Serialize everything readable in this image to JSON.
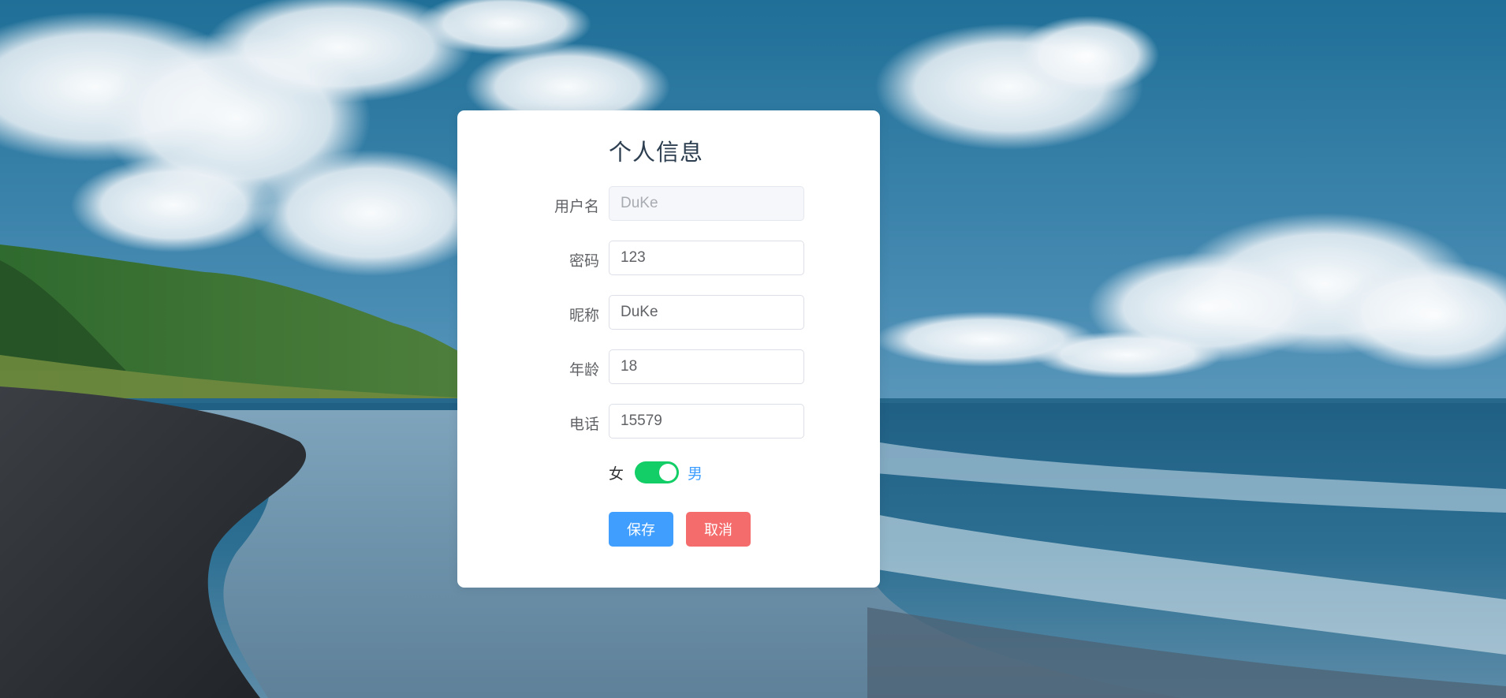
{
  "form": {
    "title": "个人信息",
    "fields": [
      {
        "label": "用户名",
        "value": "DuKe",
        "disabled": true
      },
      {
        "label": "密码",
        "value": "123",
        "disabled": false
      },
      {
        "label": "昵称",
        "value": "DuKe",
        "disabled": false
      },
      {
        "label": "年龄",
        "value": "18",
        "disabled": false
      },
      {
        "label": "电话",
        "value": "15579",
        "disabled": false
      }
    ],
    "gender": {
      "inactive_text": "女",
      "active_text": "男",
      "is_on": true
    },
    "buttons": {
      "save": "保存",
      "cancel": "取消"
    }
  },
  "colors": {
    "primary": "#409eff",
    "danger": "#f56c6c",
    "switch_on": "#13ce66"
  },
  "icons": {
    "background": "beach-landscape-image"
  }
}
